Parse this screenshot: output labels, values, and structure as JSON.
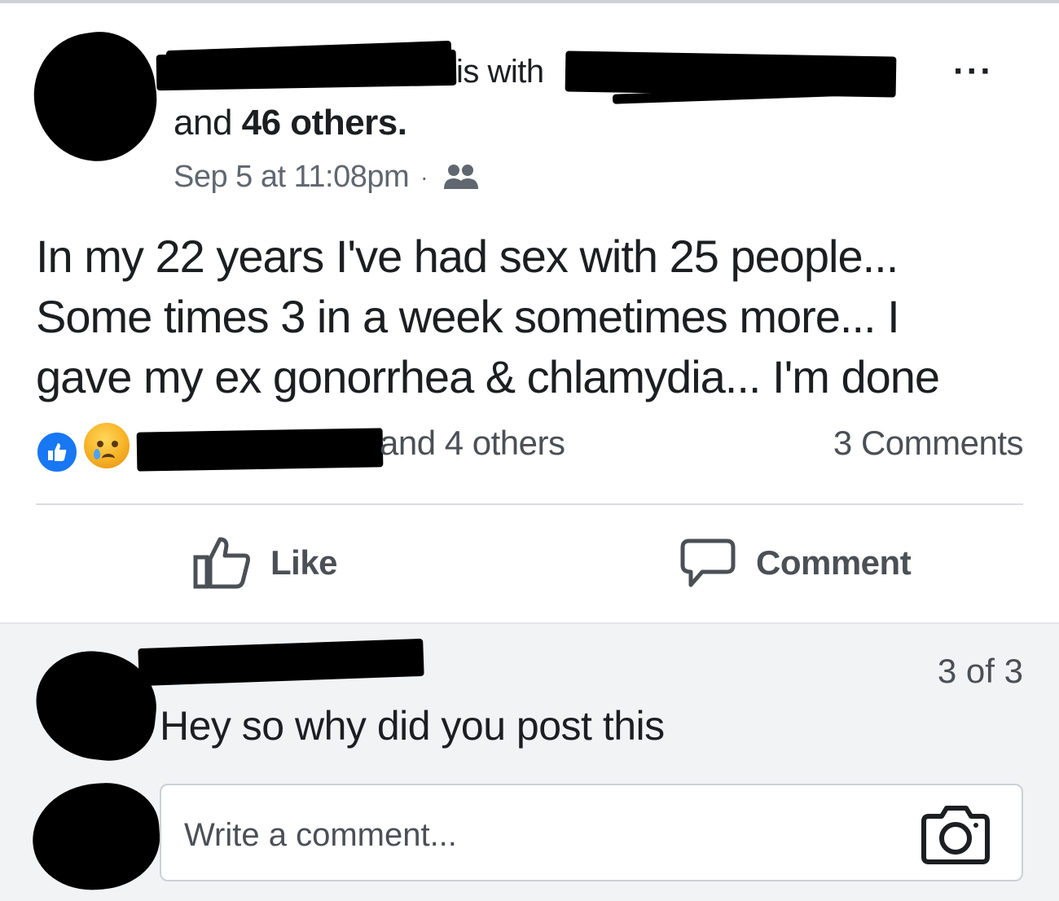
{
  "post": {
    "header_with": "is with",
    "header_and": "and ",
    "header_others": "46 others.",
    "timestamp": "Sep 5 at 11:08pm",
    "separator": "·",
    "audience_icon": "friends-icon",
    "more_icon": "more-icon",
    "more_label": "···",
    "text_lines": [
      "In my 22 years I've had sex with 25 people...",
      "Some times 3 in a week sometimes more... I",
      "gave my ex gonorrhea & chlamydia... I'm done"
    ]
  },
  "reactions": {
    "icons": [
      "like-reaction-icon",
      "sad-reaction-icon"
    ],
    "names_suffix": "and 4 others",
    "comments_count": "3 Comments"
  },
  "actions": {
    "like_label": "Like",
    "comment_label": "Comment"
  },
  "comments": {
    "pager": "3 of 3",
    "items": [
      {
        "text": "Hey so why did you post this"
      }
    ],
    "composer_placeholder": "Write a comment...",
    "camera_icon": "camera-icon"
  },
  "colors": {
    "like_blue": "#1877f2",
    "comment_area_bg": "#f2f3f5",
    "secondary_text": "#606770"
  }
}
